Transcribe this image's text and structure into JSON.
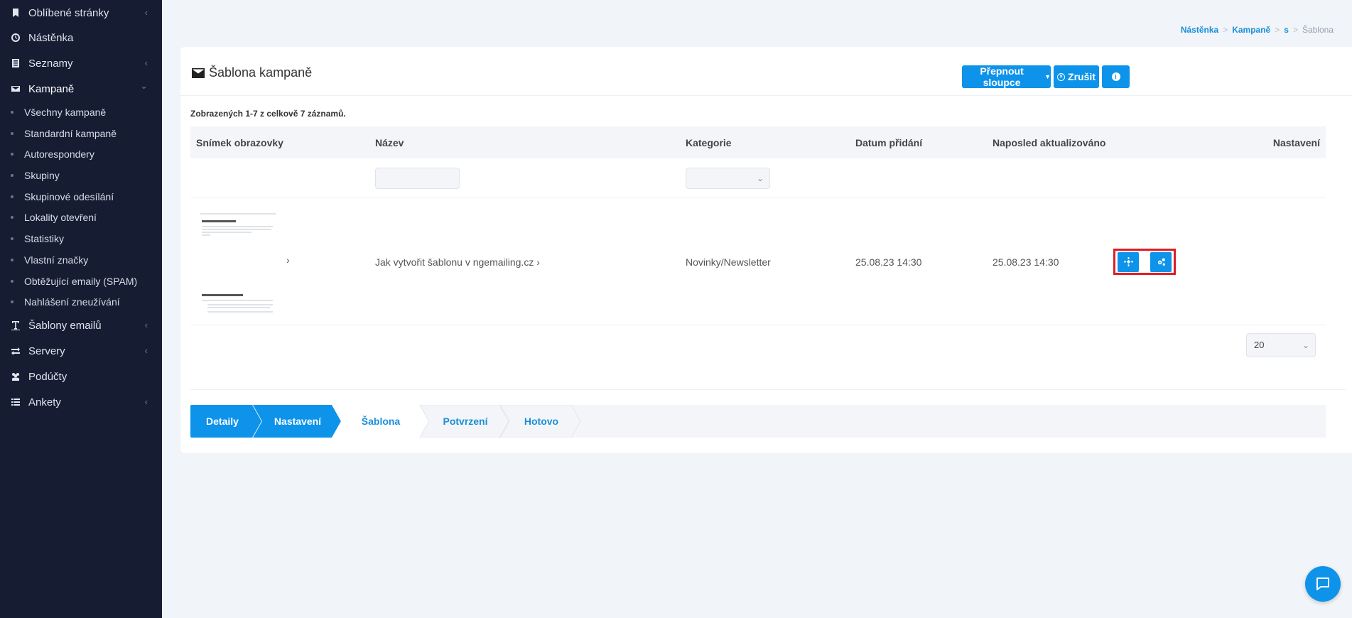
{
  "sidebar": {
    "items": [
      {
        "label": "Oblíbené stránky",
        "icon": "bookmark-icon",
        "chevron": "‹"
      },
      {
        "label": "Nástěnka",
        "icon": "dashboard-icon",
        "chevron": ""
      },
      {
        "label": "Seznamy",
        "icon": "list-icon",
        "chevron": "‹"
      },
      {
        "label": "Kampaně",
        "icon": "envelope-icon",
        "chevron": "⌄"
      },
      {
        "label": "Šablony emailů",
        "icon": "text-icon",
        "chevron": "‹"
      },
      {
        "label": "Servery",
        "icon": "exchange-icon",
        "chevron": "‹"
      },
      {
        "label": "Podúčty",
        "icon": "users-icon",
        "chevron": ""
      },
      {
        "label": "Ankety",
        "icon": "list-ul-icon",
        "chevron": "‹"
      }
    ],
    "sub_items": [
      "Všechny kampaně",
      "Standardní kampaně",
      "Autorespondery",
      "Skupiny",
      "Skupinové odesílání",
      "Lokality otevření",
      "Statistiky",
      "Vlastní značky",
      "Obtěžující emaily (SPAM)",
      "Nahlášení zneužívání"
    ]
  },
  "breadcrumb": {
    "items": [
      "Nástěnka",
      "Kampaně",
      "s"
    ],
    "separator": ">",
    "current": "Šablona"
  },
  "card": {
    "title": "Šablona kampaně",
    "buttons": {
      "toggle_columns": "Přepnout sloupce",
      "cancel": "Zrušit"
    },
    "summary": "Zobrazených 1-7 z celkově 7 záznamů."
  },
  "table": {
    "headers": [
      "Snímek obrazovky",
      "Název",
      "Kategorie",
      "Datum přidání",
      "Naposled aktualizováno",
      "Nastavení"
    ],
    "rows": [
      {
        "name": "Jak vytvořit šablonu v ngemailing.cz",
        "name_arrow": "›",
        "category": "Novinky/Newsletter",
        "date_added": "25.08.23 14:30",
        "updated": "25.08.23 14:30",
        "thumb_arrow": "›"
      }
    ]
  },
  "pagination": {
    "page_size": "20"
  },
  "wizard": {
    "steps": [
      "Detaily",
      "Nastavení",
      "Šablona",
      "Potvrzení",
      "Hotovo"
    ],
    "active_steps": 2
  },
  "colors": {
    "primary": "#0d93ea",
    "sidebar_bg": "#161d33",
    "highlight": "#e11c24"
  }
}
